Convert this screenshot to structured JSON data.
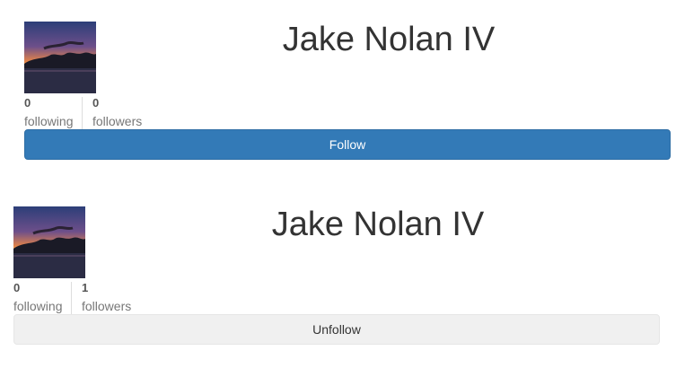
{
  "profiles": [
    {
      "name": "Jake Nolan IV",
      "following_count": "0",
      "following_label": "following",
      "followers_count": "0",
      "followers_label": "followers",
      "button_label": "Follow"
    },
    {
      "name": "Jake Nolan IV",
      "following_count": "0",
      "following_label": "following",
      "followers_count": "1",
      "followers_label": "followers",
      "button_label": "Unfollow"
    }
  ],
  "colors": {
    "primary_button": "#337ab7",
    "default_button": "#f0f0f0"
  }
}
